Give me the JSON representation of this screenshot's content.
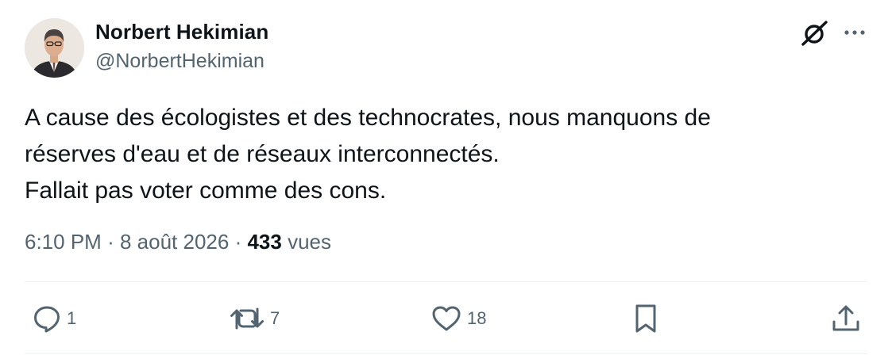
{
  "author": {
    "name": "Norbert Hekimian",
    "handle": "@NorbertHekimian"
  },
  "tweet": {
    "lines": [
      "A cause des écologistes et des technocrates, nous manquons de",
      "réserves d'eau et de réseaux interconnectés.",
      "Fallait pas voter comme des cons."
    ]
  },
  "meta": {
    "time": "6:10 PM",
    "separator": "·",
    "date": "8 août 2026",
    "views_count": "433",
    "views_label": "vues"
  },
  "actions": {
    "replies": "1",
    "reposts": "7",
    "likes": "18"
  },
  "icons": [
    "avatar",
    "grok-icon",
    "more-icon",
    "reply-icon",
    "repost-icon",
    "like-icon",
    "bookmark-icon",
    "share-icon"
  ],
  "colors": {
    "text": "#0f1419",
    "secondary": "#536471",
    "divider": "#eff3f4"
  }
}
